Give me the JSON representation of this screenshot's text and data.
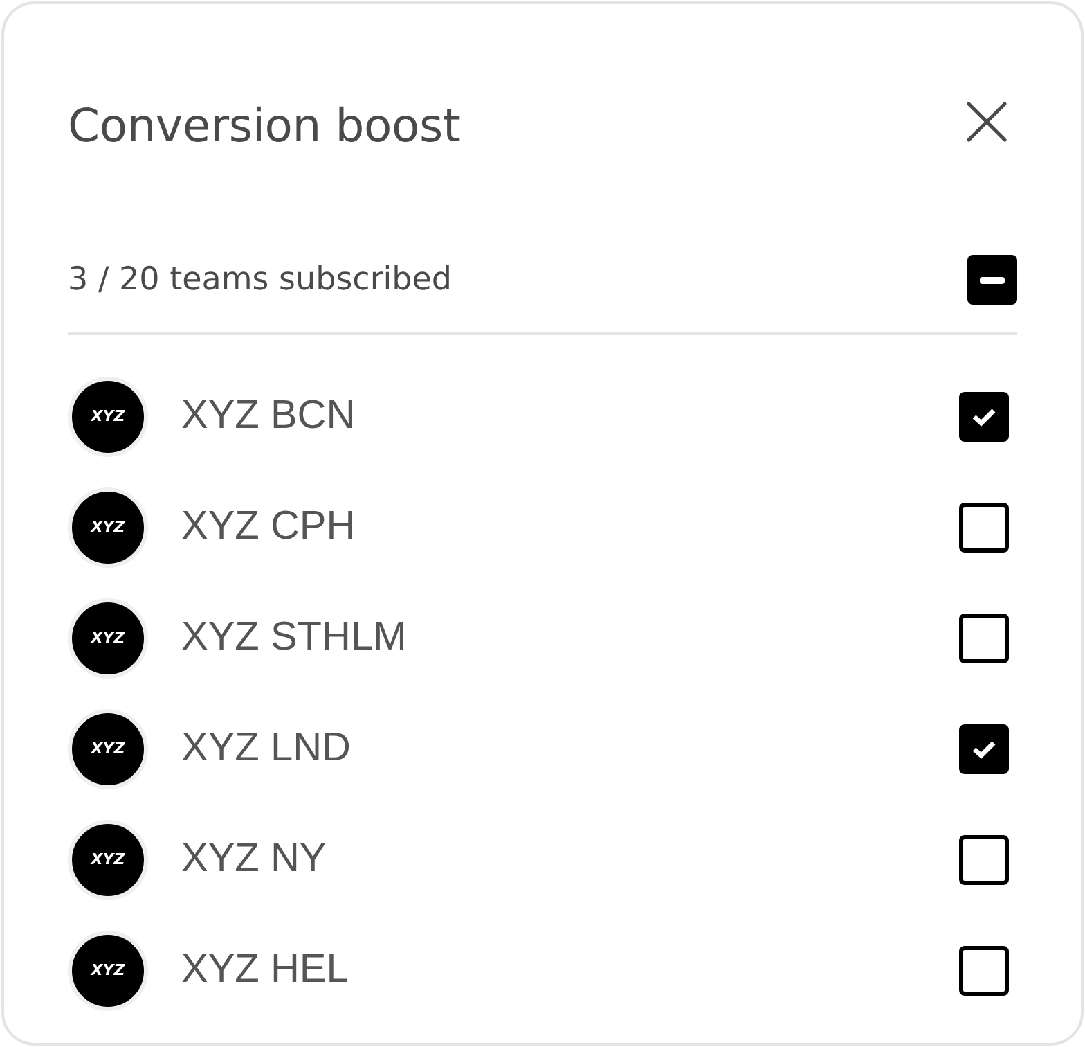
{
  "title": "Conversion boost",
  "summary": {
    "text": "3 / 20 teams subscribed",
    "select_all_indeterminate": true
  },
  "teams": [
    {
      "logo": "XYZ",
      "name": "XYZ BCN",
      "checked": true
    },
    {
      "logo": "XYZ",
      "name": "XYZ CPH",
      "checked": false
    },
    {
      "logo": "XYZ",
      "name": "XYZ STHLM",
      "checked": false
    },
    {
      "logo": "XYZ",
      "name": "XYZ LND",
      "checked": true
    },
    {
      "logo": "XYZ",
      "name": "XYZ NY",
      "checked": false
    },
    {
      "logo": "XYZ",
      "name": "XYZ HEL",
      "checked": false
    }
  ]
}
